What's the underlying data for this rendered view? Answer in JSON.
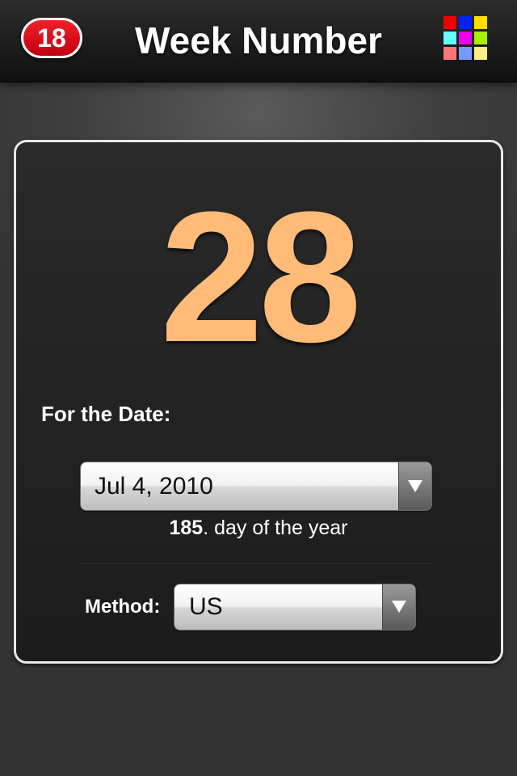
{
  "header": {
    "badge": "18",
    "title": "Week Number",
    "grid_colors": [
      "#ee0000",
      "#0022ee",
      "#ffdd00",
      "#66ffff",
      "#ee00ee",
      "#aaee00",
      "#ff7777",
      "#7799ff",
      "#ffee88"
    ]
  },
  "main": {
    "week_number": "28",
    "for_label": "For the Date:",
    "date_value": "Jul 4, 2010",
    "day_of_year": "185",
    "day_suffix": ". day of the year",
    "method_label": "Method:",
    "method_value": "US"
  },
  "colors": {
    "week_number": "#ffbb77",
    "badge": "#e0101a"
  },
  "icons": {
    "grid": "color-grid-icon",
    "dropdown": "dropdown-arrow-icon"
  }
}
